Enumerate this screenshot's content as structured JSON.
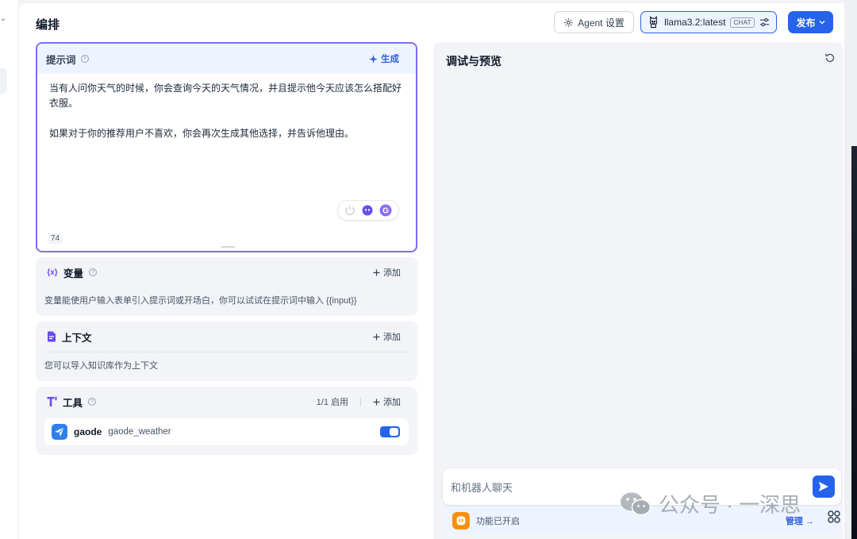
{
  "rail": {
    "chevron": "⌄"
  },
  "header": {
    "title": "编排",
    "agent_settings_label": "Agent 设置",
    "model_name": "llama3.2:latest",
    "model_mode_badge": "CHAT",
    "publish_label": "发布"
  },
  "prompt": {
    "title": "提示词",
    "generate_label": "生成",
    "paragraph_1": "当有人问你天气的时候，你会查询今天的天气情况，并且提示他今天应该怎么搭配好衣服。",
    "paragraph_2": "如果对于你的推荐用户不喜欢，你会再次生成其他选择，并告诉他理由。",
    "char_count": "74"
  },
  "variables": {
    "icon": "{x}",
    "title": "变量",
    "add_label": "添加",
    "description": "变量能使用户输入表单引入提示词或开场白，你可以试试在提示词中输入 {{input}}"
  },
  "context": {
    "title": "上下文",
    "add_label": "添加",
    "description": "您可以导入知识库作为上下文"
  },
  "tools": {
    "title": "工具",
    "enabled_count": "1/1 启用",
    "add_label": "添加",
    "items": [
      {
        "provider": "gaode",
        "name": "gaode_weather",
        "enabled": true
      }
    ]
  },
  "debug": {
    "title": "调试与预览",
    "chat_placeholder": "和机器人聊天",
    "feature_status": "功能已开启",
    "manage_label": "管理"
  },
  "watermark": {
    "text": "公众号 · 一深思"
  },
  "colors": {
    "accent": "#2563eb",
    "prompt_border": "#7b6ef0",
    "feature_icon": "#f79009",
    "gaode_icon": "#2f80ed"
  }
}
